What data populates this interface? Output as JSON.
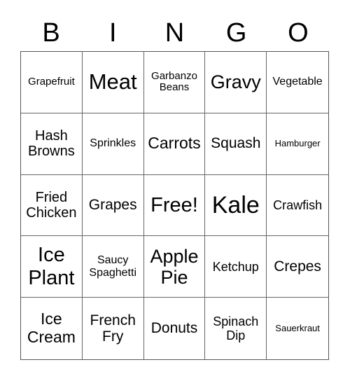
{
  "header": [
    "B",
    "I",
    "N",
    "G",
    "O"
  ],
  "cells": [
    "Grapefruit",
    "Meat",
    "Garbanzo Beans",
    "Gravy",
    "Vegetable",
    "Hash Browns",
    "Sprinkles",
    "Carrots",
    "Squash",
    "Hamburger",
    "Fried Chicken",
    "Grapes",
    "Free!",
    "Kale",
    "Crawfish",
    "Ice Plant",
    "Saucy Spaghetti",
    "Apple Pie",
    "Ketchup",
    "Crepes",
    "Ice Cream",
    "French Fry",
    "Donuts",
    "Spinach Dip",
    "Sauerkraut"
  ]
}
